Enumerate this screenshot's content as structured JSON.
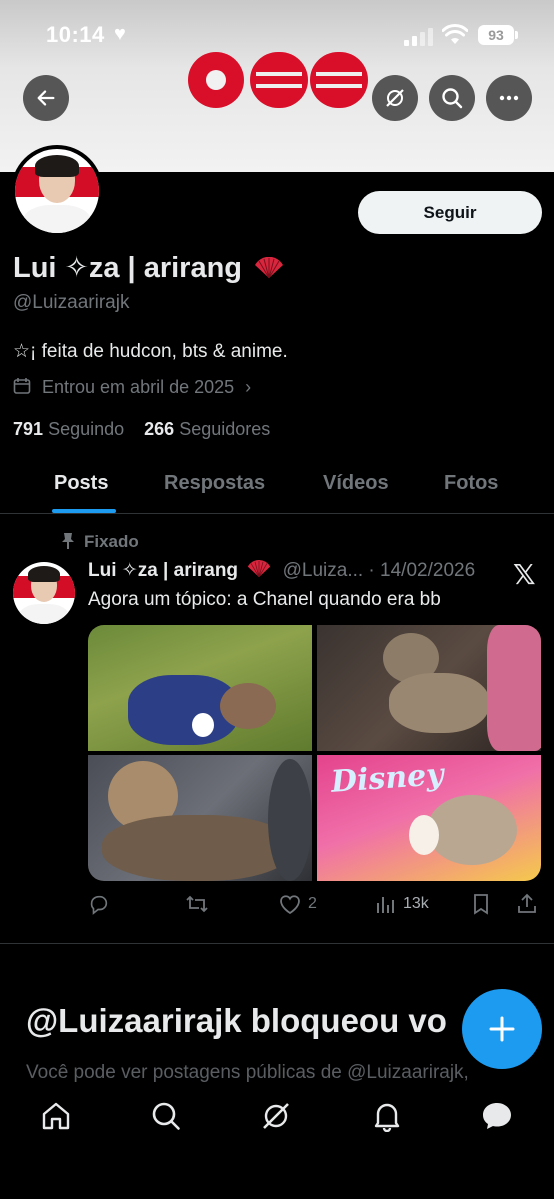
{
  "status_bar": {
    "time": "10:14",
    "battery": "93"
  },
  "profile": {
    "display_name": "Lui ✧za | arirang",
    "handle": "@Luizaarirajk",
    "bio": "☆¡ feita de hudcon, bts & anime.",
    "joined": "Entrou em abril de 2025",
    "following_count": "791",
    "following_label": "Seguindo",
    "followers_count": "266",
    "followers_label": "Seguidores",
    "follow_button": "Seguir"
  },
  "tabs": [
    "Posts",
    "Respostas",
    "Vídeos",
    "Fotos"
  ],
  "active_tab": "Posts",
  "pinned_post": {
    "pinned_label": "Fixado",
    "author_name": "Lui ✧za | arirang",
    "author_handle": "@Luiza...",
    "date": "14/02/2026",
    "text": "Agora um tópico: a Chanel quando era bb",
    "image_text": "Disney",
    "likes": "2",
    "views": "13k"
  },
  "blocked": {
    "title": "@Luizaarirajk bloqueou vo",
    "text": "Você pode ver postagens públicas de @Luizaarirajk,"
  },
  "icons": {
    "back": "back-arrow-icon",
    "grok": "grok-icon",
    "search": "search-icon",
    "more": "more-icon",
    "compose": "plus-icon"
  },
  "colors": {
    "accent": "#1d9bf0",
    "brand_red": "#d90f2a",
    "background": "#000000"
  }
}
